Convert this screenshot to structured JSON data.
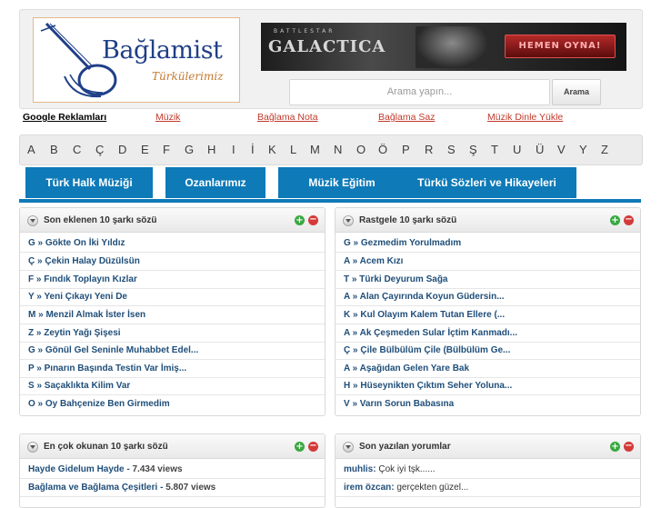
{
  "logo": {
    "title": "Bağlamist",
    "subtitle": "Türkülerimiz"
  },
  "banner": {
    "top_text": "BATTLESTAR",
    "main_text": "GALACTICA",
    "button_label": "HEMEN OYNA!"
  },
  "search": {
    "placeholder": "Arama yapın...",
    "button_label": "Arama"
  },
  "ads": {
    "title": "Google Reklamları",
    "links": [
      "Müzik",
      "Bağlama Nota",
      "Bağlama Saz",
      "Müzik Dinle Yükle"
    ]
  },
  "alphabet": [
    "A",
    "B",
    "C",
    "Ç",
    "D",
    "E",
    "F",
    "G",
    "H",
    "I",
    "İ",
    "K",
    "L",
    "M",
    "N",
    "O",
    "Ö",
    "P",
    "R",
    "S",
    "Ş",
    "T",
    "U",
    "Ü",
    "V",
    "Y",
    "Z"
  ],
  "nav": {
    "tabs": [
      "Türk Halk Müziği",
      "Ozanlarımız",
      "Müzik Eğitim",
      "Türkü Sözleri ve Hikayeleri"
    ]
  },
  "panels": {
    "latest": {
      "title": "Son eklenen 10 şarkı sözü",
      "items": [
        {
          "letter": "G",
          "text": "Gökte On İki Yıldız"
        },
        {
          "letter": "Ç",
          "text": "Çekin Halay Düzülsün"
        },
        {
          "letter": "F",
          "text": "Fındık Toplayın Kızlar"
        },
        {
          "letter": "Y",
          "text": "Yeni Çıkayı Yeni De"
        },
        {
          "letter": "M",
          "text": "Menzil Almak İster İsen"
        },
        {
          "letter": "Z",
          "text": "Zeytin Yağı Şişesi"
        },
        {
          "letter": "G",
          "text": "Gönül Gel Seninle Muhabbet Edel..."
        },
        {
          "letter": "P",
          "text": "Pınarın Başında Testin Var İmiş..."
        },
        {
          "letter": "S",
          "text": "Saçaklıkta Kilim Var"
        },
        {
          "letter": "O",
          "text": "Oy Bahçenize Ben Girmedim"
        }
      ]
    },
    "random": {
      "title": "Rastgele 10 şarkı sözü",
      "items": [
        {
          "letter": "G",
          "text": "Gezmedim Yorulmadım"
        },
        {
          "letter": "A",
          "text": "Acem Kızı"
        },
        {
          "letter": "T",
          "text": "Türki Deyurum Sağa"
        },
        {
          "letter": "A",
          "text": "Alan Çayırında Koyun Güdersin..."
        },
        {
          "letter": "K",
          "text": "Kul Olayım Kalem Tutan Ellere (..."
        },
        {
          "letter": "A",
          "text": "Ak Çeşmeden Sular İçtim Kanmadı..."
        },
        {
          "letter": "Ç",
          "text": "Çile Bülbülüm Çile (Bülbülüm Ge..."
        },
        {
          "letter": "A",
          "text": "Aşağıdan Gelen Yare Bak"
        },
        {
          "letter": "H",
          "text": "Hüseynikten Çıktım Seher Yoluna..."
        },
        {
          "letter": "V",
          "text": "Varın Sorun Babasına"
        }
      ]
    },
    "most_read": {
      "title": "En çok okunan 10 şarkı sözü",
      "items": [
        {
          "text": "Hayde Gidelum Hayde",
          "views": "7.434 views"
        },
        {
          "text": "Bağlama ve Bağlama Çeşitleri",
          "views": "5.807 views"
        }
      ]
    },
    "comments": {
      "title": "Son yazılan yorumlar",
      "items": [
        {
          "user": "muhlis",
          "comment": "Çok iyi tşk......"
        },
        {
          "user": "irem özcan",
          "comment": "gerçekten güzel..."
        }
      ]
    }
  },
  "colors": {
    "accent": "#0e7ab8",
    "link": "#1f4e79",
    "ad_link": "#c0392b",
    "logo_blue": "#1f3f88",
    "logo_orange": "#c5772e"
  }
}
